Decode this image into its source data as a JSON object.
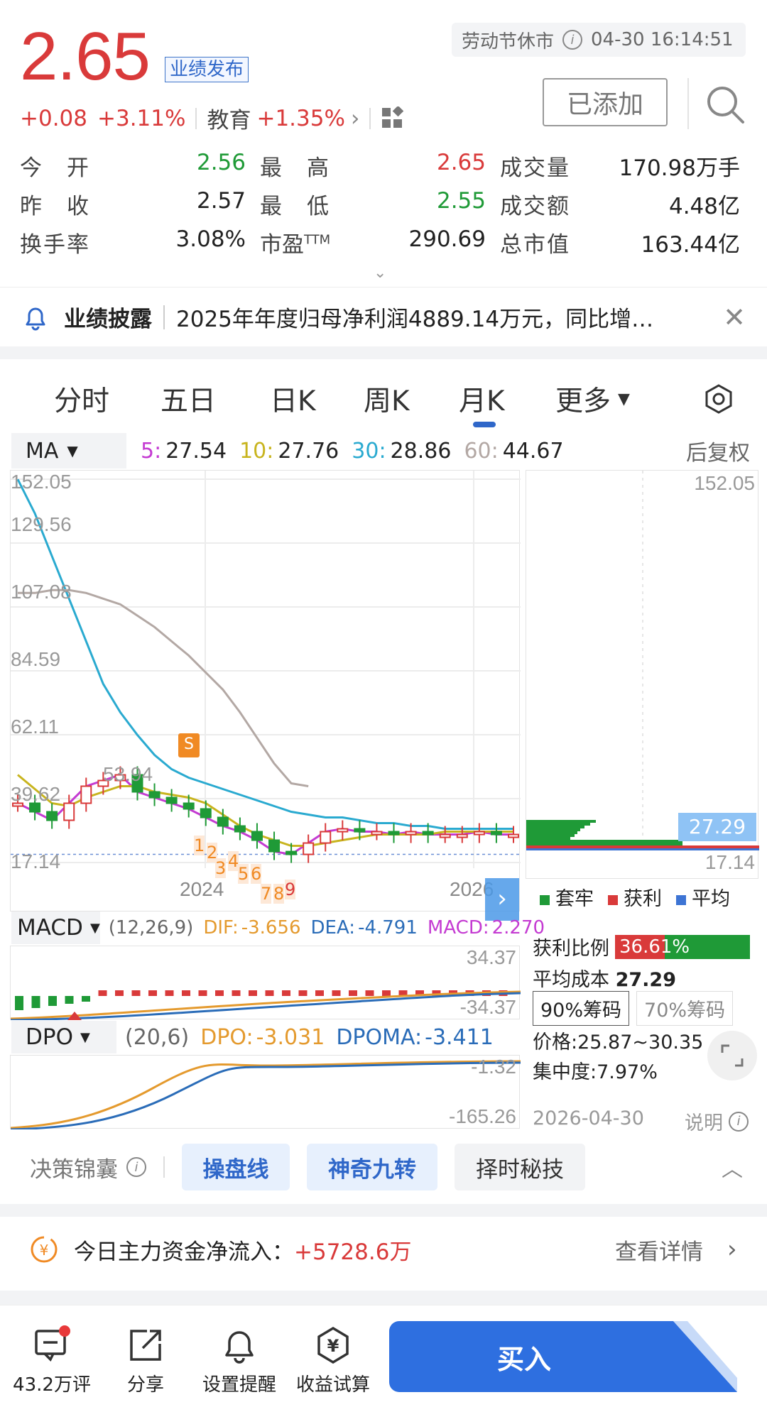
{
  "quote": {
    "price": "2.65",
    "badge": "业绩发布",
    "market_status": "劳动节休市",
    "datetime": "04-30 16:14:51",
    "change": "+0.08",
    "change_pct": "+3.11%",
    "sector": "教育",
    "sector_pct": "+1.35%",
    "added_label": "已添加"
  },
  "stats": [
    [
      {
        "label": "今　开",
        "value": "2.56",
        "color": "green"
      },
      {
        "label": "最　高",
        "value": "2.65",
        "color": "red"
      },
      {
        "label": "成交量",
        "value": "170.98万手",
        "color": "black"
      }
    ],
    [
      {
        "label": "昨　收",
        "value": "2.57",
        "color": "black"
      },
      {
        "label": "最　低",
        "value": "2.55",
        "color": "green"
      },
      {
        "label": "成交额",
        "value": "4.48亿",
        "color": "black"
      }
    ],
    [
      {
        "label": "换手率",
        "value": "3.08%",
        "color": "black"
      },
      {
        "label": "市盈TTM",
        "value": "290.69",
        "color": "black"
      },
      {
        "label": "总市值",
        "value": "163.44亿",
        "color": "black"
      }
    ]
  ],
  "notice": {
    "title": "业绩披露",
    "text": "2025年年度归母净利润4889.14万元，同比增…"
  },
  "tabs": [
    "分时",
    "五日",
    "日K",
    "周K",
    "月K",
    "更多"
  ],
  "active_tab": "月K",
  "ma": {
    "label": "MA",
    "ma5": "27.54",
    "ma10": "27.76",
    "ma30": "28.86",
    "ma60": "44.67",
    "adjust": "后复权"
  },
  "colors": {
    "ma5": "#c43bd2",
    "ma10": "#c8b41e",
    "ma30": "#2aaad0",
    "ma60": "#b3a8a4",
    "up": "#d93a3a",
    "down": "#1f9a37",
    "accent": "#2f67c9"
  },
  "chart_data": [
    {
      "type": "candlestick",
      "title": "月K",
      "y_ticks": [
        "152.05",
        "129.56",
        "107.08",
        "84.59",
        "62.11",
        "39.62",
        "17.14"
      ],
      "ylim": [
        17.14,
        152.05
      ],
      "x_ticks": [
        "2024",
        "2026"
      ],
      "max_label": "53.94",
      "signal_label": "S",
      "nine_turn_labels": [
        "1",
        "2",
        "3",
        "4",
        "5",
        "6",
        "7",
        "8",
        "9"
      ],
      "series": [
        {
          "name": "5",
          "values": [
            38,
            35,
            32,
            38,
            44,
            46,
            48,
            42,
            40,
            38,
            36,
            33,
            30,
            28,
            25,
            21,
            20,
            24,
            28,
            29,
            28,
            28,
            27,
            28,
            27,
            27,
            27,
            28,
            27,
            27
          ]
        },
        {
          "name": "10",
          "values": [
            48,
            43,
            38,
            37,
            40,
            42,
            44,
            44,
            42,
            41,
            40,
            38,
            34,
            30,
            27,
            25,
            23,
            23,
            24,
            25,
            26,
            27,
            27,
            27,
            27,
            28,
            28,
            28,
            28,
            28
          ]
        },
        {
          "name": "30",
          "values": [
            152,
            140,
            125,
            110,
            95,
            80,
            70,
            62,
            55,
            50,
            47,
            45,
            43,
            41,
            39,
            37,
            35,
            34,
            33,
            33,
            32,
            31,
            31,
            30,
            30,
            29,
            29,
            29,
            29,
            29
          ]
        },
        {
          "name": "60",
          "values": [
            112,
            112,
            113,
            113,
            112,
            110,
            108,
            104,
            100,
            95,
            90,
            84,
            78,
            70,
            61,
            52,
            45,
            44
          ]
        }
      ]
    },
    {
      "type": "bar",
      "title": "MACD",
      "params": "(12,26,9)",
      "dif": "-3.656",
      "dea": "-4.791",
      "macd": "2.270",
      "y_ticks": [
        "34.37",
        "-34.37"
      ]
    },
    {
      "type": "line",
      "title": "DPO",
      "params": "(20,6)",
      "dpo": "-3.031",
      "dpoma": "-3.411",
      "y_ticks": [
        "-1.32",
        "-165.26"
      ]
    }
  ],
  "chips": {
    "price_label": "27.29",
    "bottom_label": "17.14",
    "top_label": "152.05",
    "legend": [
      "套牢",
      "获利",
      "平均"
    ],
    "profit_ratio_label": "获利比例",
    "profit_ratio": "36.61%",
    "profit_fraction": 0.3661,
    "avg_cost_label": "平均成本",
    "avg_cost": "27.29",
    "btn90": "90%筹码",
    "btn70": "70%筹码",
    "price_range": "价格:25.87~30.35",
    "concentration": "集中度:7.97%",
    "date": "2026-04-30",
    "explain": "说明"
  },
  "strategy": {
    "label": "决策锦囊",
    "items": [
      "操盘线",
      "神奇九转",
      "择时秘技"
    ]
  },
  "flow": {
    "label": "今日主力资金净流入：",
    "value": "+5728.6万",
    "detail": "查看详情"
  },
  "bottom": {
    "comments": "43.2万评",
    "share": "分享",
    "alert": "设置提醒",
    "calc": "收益试算",
    "buy": "买入"
  }
}
